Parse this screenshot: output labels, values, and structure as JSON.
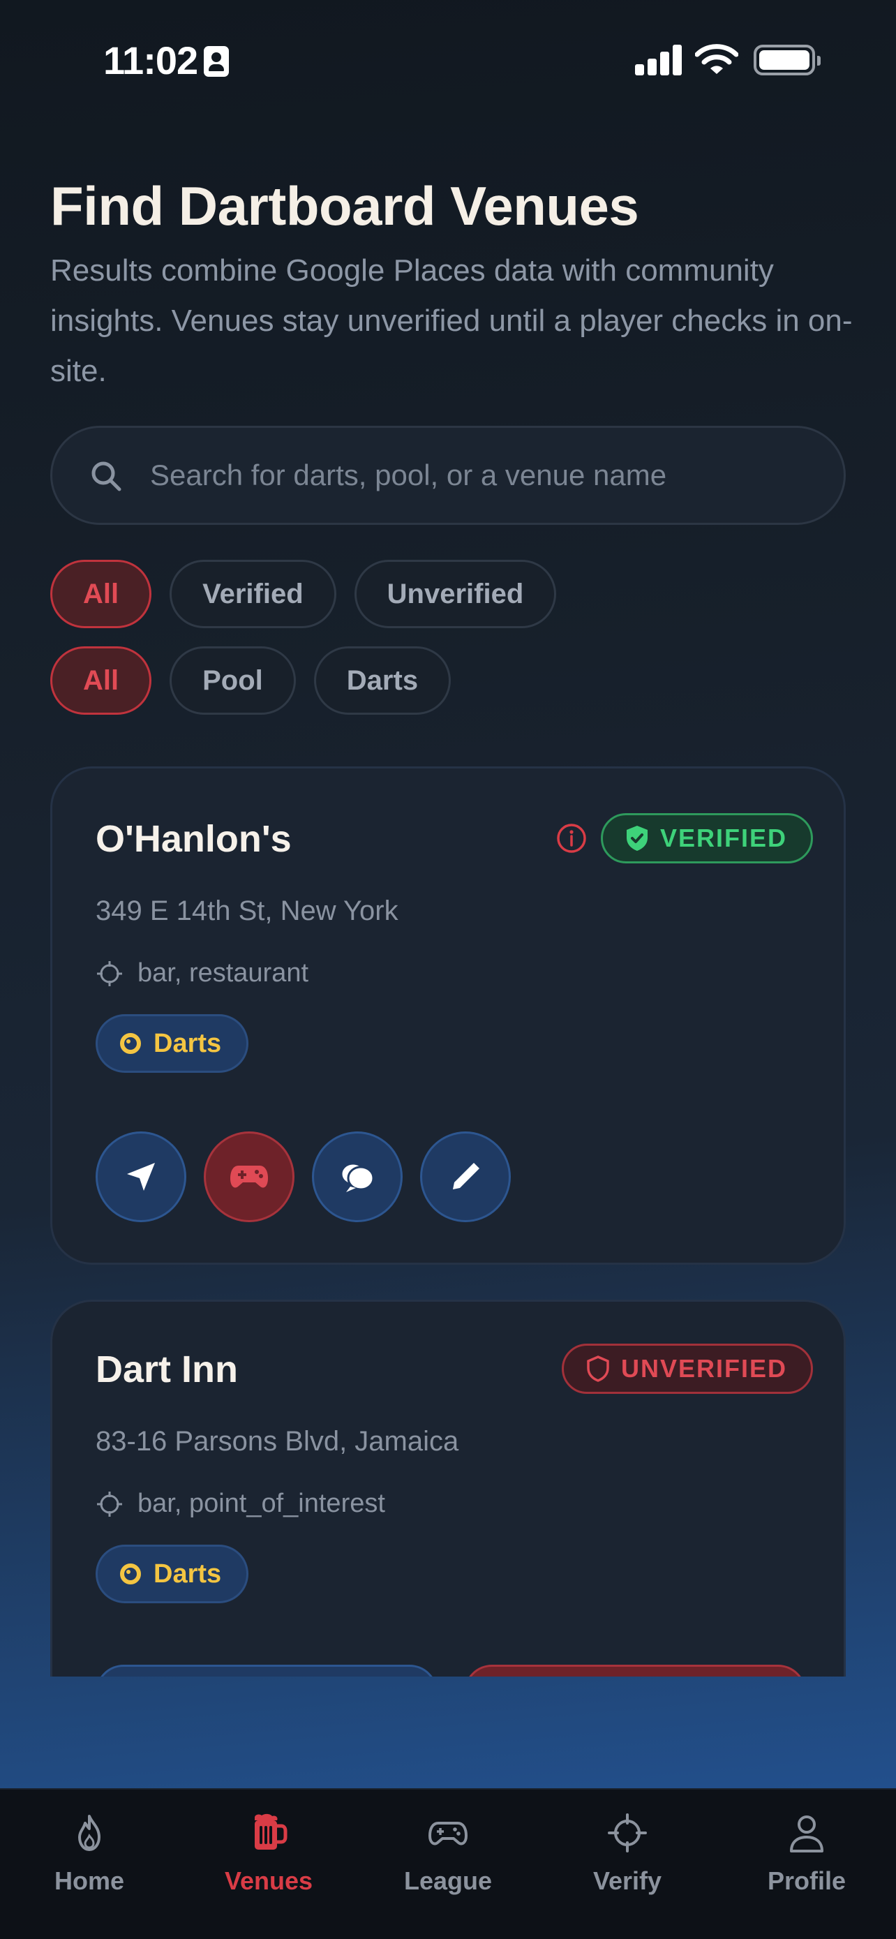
{
  "status_bar": {
    "time": "11:02"
  },
  "header": {
    "title": "Find Dartboard Venues",
    "subtitle": "Results combine Google Places data with community insights. Venues stay unverified until a player checks in on-site."
  },
  "search": {
    "placeholder": "Search for darts, pool, or a venue name",
    "value": ""
  },
  "filters": {
    "verification": [
      {
        "label": "All",
        "active": true
      },
      {
        "label": "Verified",
        "active": false
      },
      {
        "label": "Unverified",
        "active": false
      }
    ],
    "game": [
      {
        "label": "All",
        "active": true
      },
      {
        "label": "Pool",
        "active": false
      },
      {
        "label": "Darts",
        "active": false
      }
    ]
  },
  "venues": [
    {
      "name": "O'Hanlon's",
      "address": "349 E 14th St, New York",
      "types": "bar, restaurant",
      "tag": "Darts",
      "status": "VERIFIED"
    },
    {
      "name": "Dart Inn",
      "address": "83-16 Parsons Blvd, Jamaica",
      "types": "bar, point_of_interest",
      "tag": "Darts",
      "status": "UNVERIFIED"
    }
  ],
  "tabs": [
    {
      "label": "Home",
      "icon": "flame-icon",
      "active": false
    },
    {
      "label": "Venues",
      "icon": "beer-mug-icon",
      "active": true
    },
    {
      "label": "League",
      "icon": "gamepad-icon",
      "active": false
    },
    {
      "label": "Verify",
      "icon": "crosshair-icon",
      "active": false
    },
    {
      "label": "Profile",
      "icon": "person-icon",
      "active": false
    }
  ],
  "colors": {
    "accent": "#d93c46",
    "verified": "#3ed27a",
    "tag": "#f4c542",
    "background": "#17202b"
  }
}
